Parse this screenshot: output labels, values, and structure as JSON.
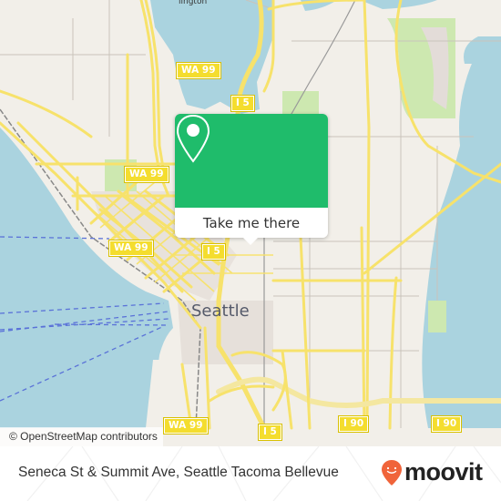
{
  "map": {
    "city_label": "Seattle",
    "district_label": "lington",
    "attribution": "© OpenStreetMap contributors",
    "shields": [
      {
        "id": "wa99-north",
        "label": "WA 99"
      },
      {
        "id": "i5-north",
        "label": "I 5"
      },
      {
        "id": "wa99-mid",
        "label": "WA 99"
      },
      {
        "id": "wa99-west",
        "label": "WA 99"
      },
      {
        "id": "i5-center",
        "label": "I 5"
      },
      {
        "id": "wa99-south",
        "label": "WA 99"
      },
      {
        "id": "i5-south",
        "label": "I 5"
      },
      {
        "id": "i90-west",
        "label": "I 90"
      },
      {
        "id": "i90-east",
        "label": "I 90"
      }
    ],
    "colors": {
      "water": "#aad3df",
      "land": "#f2efe9",
      "road": "#f7e26b",
      "park": "#cde8b0",
      "popup": "#1fbc6b",
      "brand": "#f0643a"
    }
  },
  "popup": {
    "action_label": "Take me there",
    "icon": "map-pin-icon"
  },
  "footer": {
    "address": "Seneca St & Summit Ave, Seattle Tacoma Bellevue",
    "brand_name": "moovit",
    "brand_icon": "moovit-logo-icon"
  }
}
